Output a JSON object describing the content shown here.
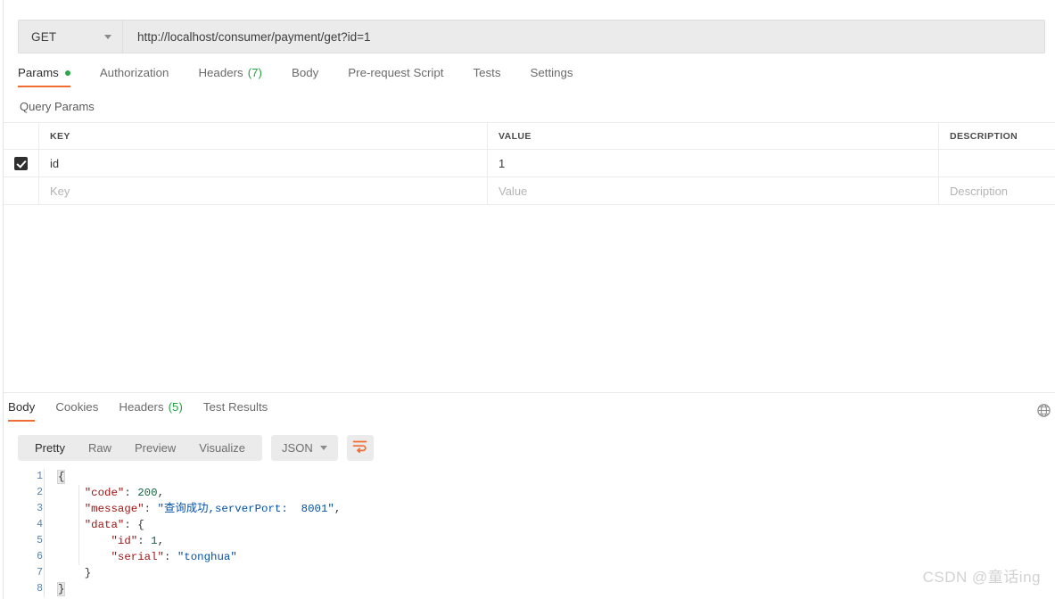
{
  "request": {
    "method": "GET",
    "url": "http://localhost/consumer/payment/get?id=1",
    "tabs": [
      {
        "label": "Params",
        "badge": "",
        "dot": true,
        "active": true
      },
      {
        "label": "Authorization",
        "badge": "",
        "dot": false,
        "active": false
      },
      {
        "label": "Headers",
        "badge": "(7)",
        "dot": false,
        "active": false
      },
      {
        "label": "Body",
        "badge": "",
        "dot": false,
        "active": false
      },
      {
        "label": "Pre-request Script",
        "badge": "",
        "dot": false,
        "active": false
      },
      {
        "label": "Tests",
        "badge": "",
        "dot": false,
        "active": false
      },
      {
        "label": "Settings",
        "badge": "",
        "dot": false,
        "active": false
      }
    ],
    "section_title": "Query Params",
    "table": {
      "columns": [
        "KEY",
        "VALUE",
        "DESCRIPTION"
      ],
      "rows": [
        {
          "checked": true,
          "key": "id",
          "value": "1",
          "description": ""
        }
      ],
      "placeholders": {
        "key": "Key",
        "value": "Value",
        "description": "Description"
      }
    }
  },
  "response": {
    "tabs": [
      {
        "label": "Body",
        "badge": "",
        "active": true
      },
      {
        "label": "Cookies",
        "badge": "",
        "active": false
      },
      {
        "label": "Headers",
        "badge": "(5)",
        "active": false
      },
      {
        "label": "Test Results",
        "badge": "",
        "active": false
      }
    ],
    "view_modes": [
      {
        "label": "Pretty",
        "active": true
      },
      {
        "label": "Raw",
        "active": false
      },
      {
        "label": "Preview",
        "active": false
      },
      {
        "label": "Visualize",
        "active": false
      }
    ],
    "format": "JSON",
    "body_lines": [
      {
        "n": "1",
        "text": "{"
      },
      {
        "n": "2",
        "text": "    \"code\": 200,"
      },
      {
        "n": "3",
        "text": "    \"message\": \"查询成功,serverPort:  8001\","
      },
      {
        "n": "4",
        "text": "    \"data\": {"
      },
      {
        "n": "5",
        "text": "        \"id\": 1,"
      },
      {
        "n": "6",
        "text": "        \"serial\": \"tonghua\""
      },
      {
        "n": "7",
        "text": "    }"
      },
      {
        "n": "8",
        "text": "}"
      }
    ],
    "body_json": {
      "code": 200,
      "message": "查询成功,serverPort:  8001",
      "data": {
        "id": 1,
        "serial": "tonghua"
      }
    }
  },
  "watermark": "CSDN @童话ing",
  "colors": {
    "accent": "#ef6c33",
    "badge_green": "#25a244",
    "dot_green": "#2aa746",
    "toolbar_bg": "#ebebeb",
    "border": "#ececec",
    "json_key": "#a31515",
    "json_string": "#0451a5",
    "json_number": "#116644",
    "watermark": "#d2d2d2"
  }
}
